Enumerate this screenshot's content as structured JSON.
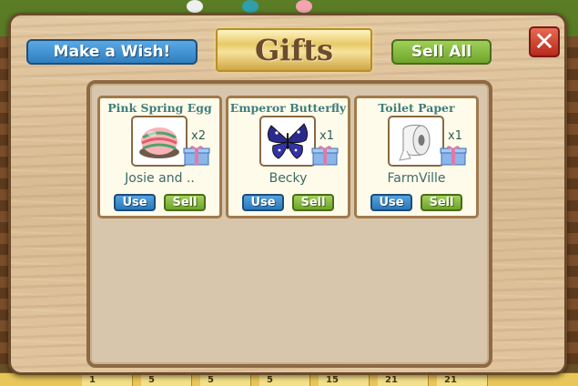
{
  "dialog": {
    "title": "Gifts",
    "make_wish_label": "Make a Wish!",
    "sell_all_label": "Sell All",
    "close_symbol": "✕"
  },
  "gifts": [
    {
      "name": "Pink Spring Egg",
      "quantity": "x2",
      "sender": "Josie and ..",
      "use_label": "Use",
      "sell_label": "Sell",
      "icon": "egg-icon"
    },
    {
      "name": "Emperor Butterfly",
      "quantity": "x1",
      "sender": "Becky",
      "use_label": "Use",
      "sell_label": "Sell",
      "icon": "butterfly-icon"
    },
    {
      "name": "Toilet Paper",
      "quantity": "x1",
      "sender": "FarmVille",
      "use_label": "Use",
      "sell_label": "Sell",
      "icon": "toilet-paper-icon"
    }
  ],
  "bottom_bar": {
    "tiles": [
      "1",
      "5",
      "5",
      "5",
      "15",
      "21",
      "21"
    ]
  },
  "colors": {
    "blue_button": "#2f7fc1",
    "green_button": "#6fa52a",
    "close_button": "#b8281c",
    "title_gold": "#e7c968",
    "item_title": "#3d7e7c"
  }
}
